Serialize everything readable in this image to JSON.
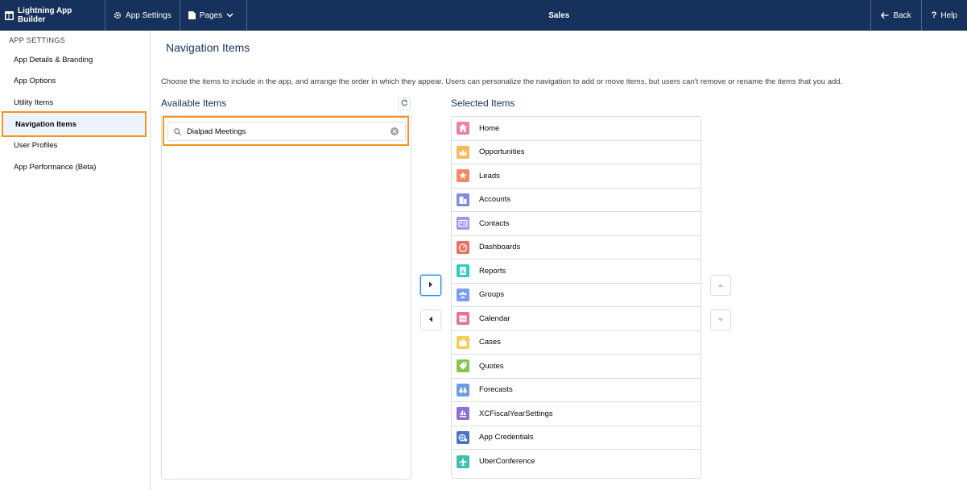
{
  "topbar": {
    "brand": "Lightning App Builder",
    "app_settings": "App Settings",
    "pages": "Pages",
    "title": "Sales",
    "back": "Back",
    "help": "Help"
  },
  "sidebar": {
    "heading": "APP SETTINGS",
    "items": [
      {
        "label": "App Details & Branding"
      },
      {
        "label": "App Options"
      },
      {
        "label": "Utility Items"
      },
      {
        "label": "Navigation Items",
        "active": true
      },
      {
        "label": "User Profiles"
      },
      {
        "label": "App Performance (Beta)"
      }
    ]
  },
  "main": {
    "title": "Navigation Items",
    "description": "Choose the items to include in the app, and arrange the order in which they appear. Users can personalize the navigation to add or move items, but users can't remove or rename the items that you add.",
    "available": {
      "label": "Available Items",
      "search_value": "Dialpad Meetings"
    },
    "selected": {
      "label": "Selected Items",
      "items": [
        {
          "label": "Home",
          "icon": "home-icon",
          "color": "#ef7ead"
        },
        {
          "label": "Opportunities",
          "icon": "crown-icon",
          "color": "#fcb95b"
        },
        {
          "label": "Leads",
          "icon": "lead-star-icon",
          "color": "#f88962"
        },
        {
          "label": "Accounts",
          "icon": "building-icon",
          "color": "#7f8de1"
        },
        {
          "label": "Contacts",
          "icon": "contact-card-icon",
          "color": "#a094ed"
        },
        {
          "label": "Dashboards",
          "icon": "gauge-icon",
          "color": "#ef6e64"
        },
        {
          "label": "Reports",
          "icon": "report-icon",
          "color": "#2ecbbe"
        },
        {
          "label": "Groups",
          "icon": "groups-icon",
          "color": "#779ef2"
        },
        {
          "label": "Calendar",
          "icon": "calendar-icon",
          "color": "#eb7092"
        },
        {
          "label": "Cases",
          "icon": "briefcase-icon",
          "color": "#f2cf5b"
        },
        {
          "label": "Quotes",
          "icon": "tag-icon",
          "color": "#88c651"
        },
        {
          "label": "Forecasts",
          "icon": "binoculars-icon",
          "color": "#6b9ee2"
        },
        {
          "label": "XCFiscalYearSettings",
          "icon": "sailboat-icon",
          "color": "#8b70d8"
        },
        {
          "label": "App Credentials",
          "icon": "globe-key-icon",
          "color": "#4a74c4"
        },
        {
          "label": "UberConference",
          "icon": "plane-icon",
          "color": "#3ebfac"
        }
      ]
    }
  }
}
